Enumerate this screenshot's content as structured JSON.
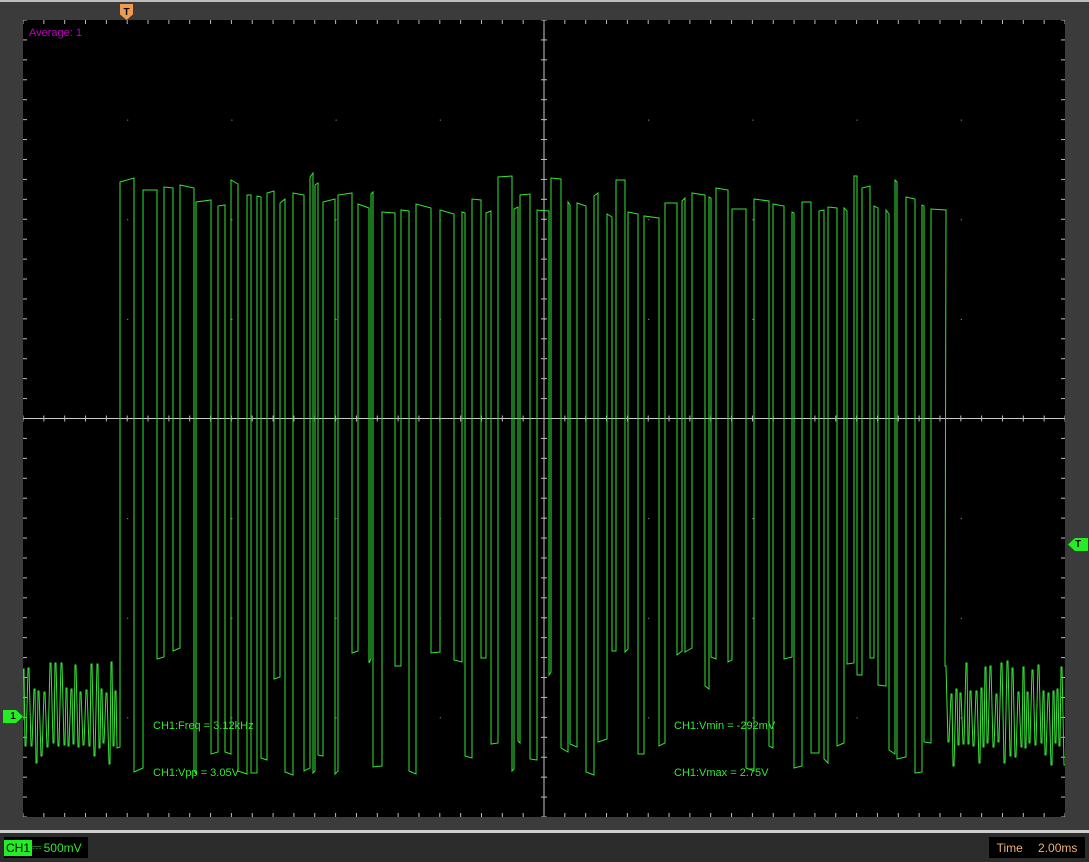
{
  "display": {
    "average_label": "Average: 1",
    "measurements": {
      "freq": "CH1:Freq = 3.12kHz",
      "vpp": "CH1:Vpp = 3.05V",
      "vmin": "CH1:Vmin = -292mV",
      "vmax": "CH1:Vmax = 2.75V"
    },
    "trigger_marker": "T",
    "channel_marker": "1",
    "colors": {
      "trace": "#33e633",
      "grid": "#c8c8c8",
      "trigger": "#f09a50",
      "average": "#c000c0"
    }
  },
  "status_bar": {
    "channel_tag": "CH1",
    "channel_coupling": "⎓",
    "channel_scale": "500mV",
    "time_label": "Time",
    "time_value": "2.00ms"
  }
}
